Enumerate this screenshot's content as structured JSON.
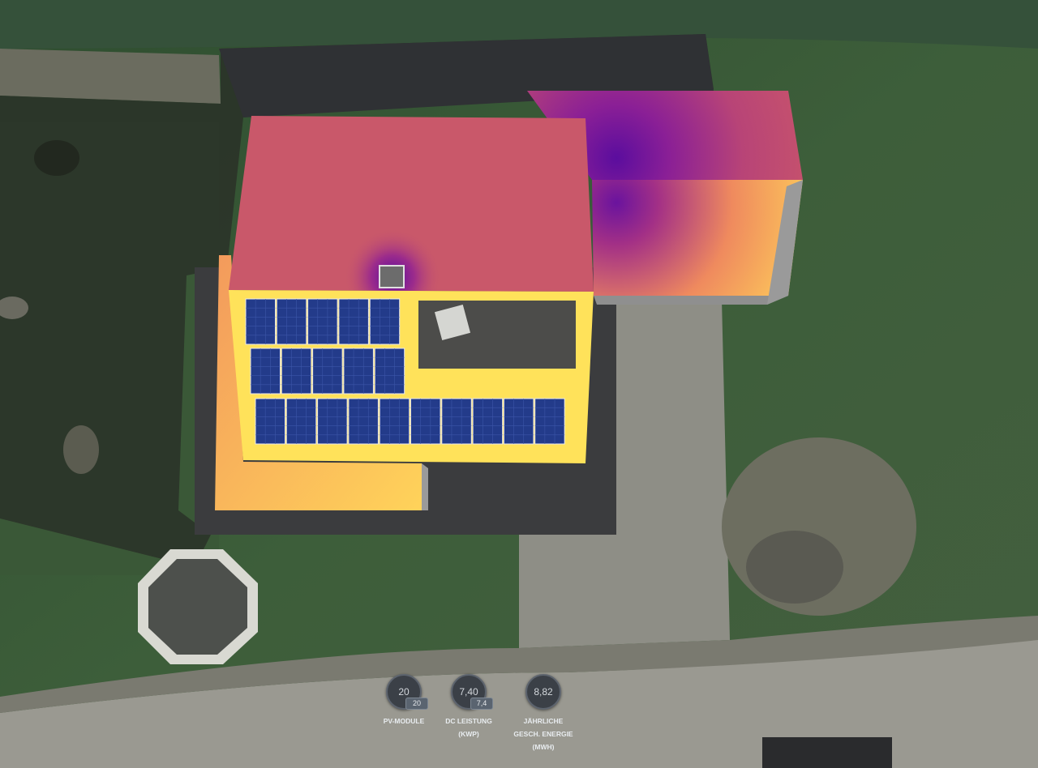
{
  "stats": [
    {
      "id": "pv-modules",
      "value": "20",
      "sub_value": "20",
      "label_lines": [
        "PV-MODULE"
      ]
    },
    {
      "id": "dc-power",
      "value": "7,40",
      "sub_value": "7,4",
      "label_lines": [
        "DC LEISTUNG",
        "(kWp)"
      ]
    },
    {
      "id": "annual-energy",
      "value": "8,82",
      "sub_value": "",
      "label_lines": [
        "JÄHRLICHE",
        "GESCH. ENERGIE",
        "(MWh)"
      ]
    }
  ],
  "solar_array": {
    "module_count": 20,
    "rows": [
      5,
      5,
      10
    ]
  },
  "colors": {
    "roof_high": "#ffe25a",
    "roof_mid": "#cf5c6b",
    "roof_shade": "#5b0d9e",
    "panel": "#233b8a",
    "stat_bg": "#3b4047"
  }
}
